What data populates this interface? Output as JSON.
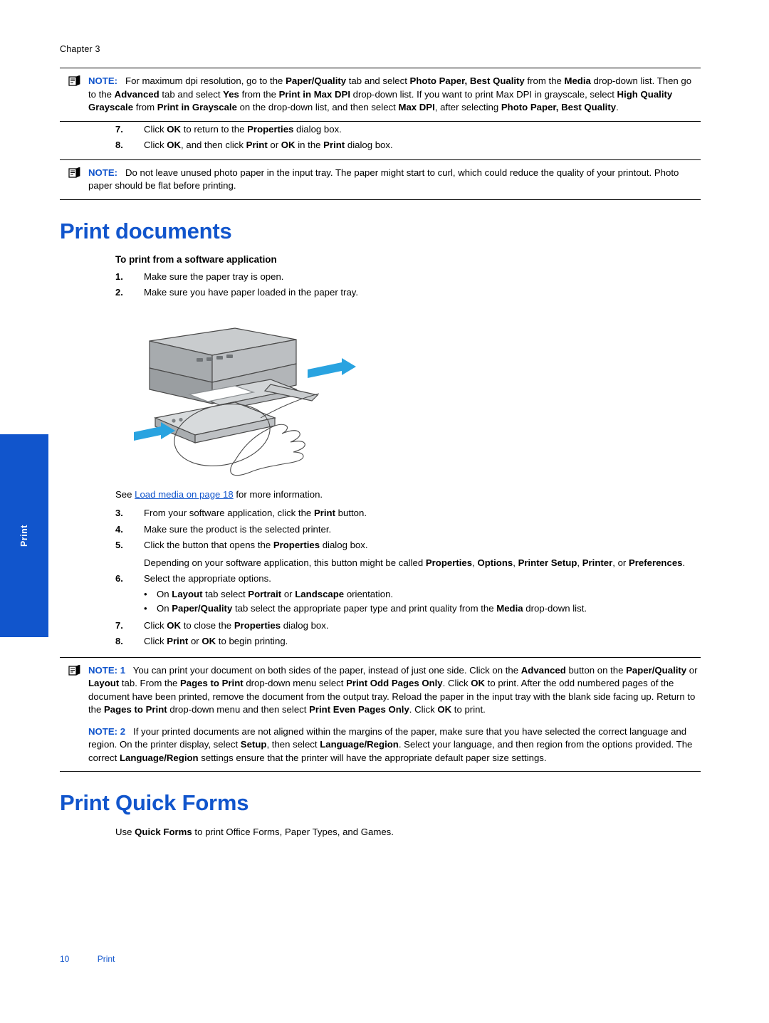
{
  "header": {
    "chapter": "Chapter 3"
  },
  "side_tab": {
    "label": "Print",
    "color": "#1155cc"
  },
  "notes": {
    "note1": {
      "label": "NOTE:",
      "icon": "note-pencil-icon",
      "text_runs": [
        {
          "t": "For maximum dpi resolution, go to the ",
          "b": false
        },
        {
          "t": "Paper/Quality",
          "b": true
        },
        {
          "t": " tab and select ",
          "b": false
        },
        {
          "t": "Photo Paper, Best Quality",
          "b": true
        },
        {
          "t": " from the ",
          "b": false
        },
        {
          "t": "Media",
          "b": true
        },
        {
          "t": " drop-down list. Then go to the ",
          "b": false
        },
        {
          "t": "Advanced",
          "b": true
        },
        {
          "t": " tab and select ",
          "b": false
        },
        {
          "t": "Yes",
          "b": true
        },
        {
          "t": " from the ",
          "b": false
        },
        {
          "t": "Print in Max DPI",
          "b": true
        },
        {
          "t": " drop-down list. If you want to print Max DPI in grayscale, select ",
          "b": false
        },
        {
          "t": "High Quality Grayscale",
          "b": true
        },
        {
          "t": " from ",
          "b": false
        },
        {
          "t": "Print in Grayscale",
          "b": true
        },
        {
          "t": " on the drop-down list, and then select ",
          "b": false
        },
        {
          "t": "Max DPI",
          "b": true
        },
        {
          "t": ", after selecting ",
          "b": false
        },
        {
          "t": "Photo Paper, Best Quality",
          "b": true
        },
        {
          "t": ".",
          "b": false
        }
      ]
    },
    "note2": {
      "label": "NOTE:",
      "icon": "note-pencil-icon",
      "text_runs": [
        {
          "t": "Do not leave unused photo paper in the input tray. The paper might start to curl, which could reduce the quality of your printout. Photo paper should be flat before printing.",
          "b": false
        }
      ]
    },
    "note3": {
      "label": "NOTE: 1",
      "icon": "note-pencil-icon",
      "text_runs": [
        {
          "t": "You can print your document on both sides of the paper, instead of just one side. Click on the ",
          "b": false
        },
        {
          "t": "Advanced",
          "b": true
        },
        {
          "t": " button on the ",
          "b": false
        },
        {
          "t": "Paper/Quality",
          "b": true
        },
        {
          "t": " or ",
          "b": false
        },
        {
          "t": "Layout",
          "b": true
        },
        {
          "t": " tab. From the ",
          "b": false
        },
        {
          "t": "Pages to Print",
          "b": true
        },
        {
          "t": " drop-down menu select ",
          "b": false
        },
        {
          "t": "Print Odd Pages Only",
          "b": true
        },
        {
          "t": ". Click ",
          "b": false
        },
        {
          "t": "OK",
          "b": true
        },
        {
          "t": " to print. After the odd numbered pages of the document have been printed, remove the document from the output tray. Reload the paper in the input tray with the blank side facing up. Return to the ",
          "b": false
        },
        {
          "t": "Pages to Print",
          "b": true
        },
        {
          "t": " drop-down menu and then select ",
          "b": false
        },
        {
          "t": "Print Even Pages Only",
          "b": true
        },
        {
          "t": ". Click ",
          "b": false
        },
        {
          "t": "OK",
          "b": true
        },
        {
          "t": " to print.",
          "b": false
        }
      ],
      "sub_label": "NOTE: 2",
      "sub_runs": [
        {
          "t": "If your printed documents are not aligned within the margins of the paper, make sure that you have selected the correct language and region. On the printer display, select ",
          "b": false
        },
        {
          "t": "Setup",
          "b": true
        },
        {
          "t": ", then select ",
          "b": false
        },
        {
          "t": "Language/Region",
          "b": true
        },
        {
          "t": ". Select your language, and then region from the options provided. The correct ",
          "b": false
        },
        {
          "t": "Language/Region",
          "b": true
        },
        {
          "t": " settings ensure that the printer will have the appropriate default paper size settings.",
          "b": false
        }
      ]
    }
  },
  "top_steps": [
    {
      "num": "7.",
      "runs": [
        {
          "t": "Click ",
          "b": false
        },
        {
          "t": "OK",
          "b": true
        },
        {
          "t": " to return to the ",
          "b": false
        },
        {
          "t": "Properties",
          "b": true
        },
        {
          "t": " dialog box.",
          "b": false
        }
      ]
    },
    {
      "num": "8.",
      "runs": [
        {
          "t": "Click ",
          "b": false
        },
        {
          "t": "OK",
          "b": true
        },
        {
          "t": ", and then click ",
          "b": false
        },
        {
          "t": "Print",
          "b": true
        },
        {
          "t": " or ",
          "b": false
        },
        {
          "t": "OK",
          "b": true
        },
        {
          "t": " in the ",
          "b": false
        },
        {
          "t": "Print",
          "b": true
        },
        {
          "t": " dialog box.",
          "b": false
        }
      ]
    }
  ],
  "section1": {
    "heading": "Print documents",
    "subhead": "To print from a software application",
    "steps_before_image": [
      {
        "num": "1.",
        "runs": [
          {
            "t": "Make sure the paper tray is open.",
            "b": false
          }
        ]
      },
      {
        "num": "2.",
        "runs": [
          {
            "t": "Make sure you have paper loaded in the paper tray.",
            "b": false
          }
        ]
      }
    ],
    "see_also": {
      "prefix": "See ",
      "link": "Load media on page 18",
      "suffix": " for more information."
    },
    "steps_after_image": [
      {
        "num": "3.",
        "runs": [
          {
            "t": "From your software application, click the ",
            "b": false
          },
          {
            "t": "Print",
            "b": true
          },
          {
            "t": " button.",
            "b": false
          }
        ]
      },
      {
        "num": "4.",
        "runs": [
          {
            "t": "Make sure the product is the selected printer.",
            "b": false
          }
        ]
      },
      {
        "num": "5.",
        "runs": [
          {
            "t": "Click the button that opens the ",
            "b": false
          },
          {
            "t": "Properties",
            "b": true
          },
          {
            "t": " dialog box.",
            "b": false
          }
        ],
        "extra_runs": [
          {
            "t": "Depending on your software application, this button might be called ",
            "b": false
          },
          {
            "t": "Properties",
            "b": true
          },
          {
            "t": ", ",
            "b": false
          },
          {
            "t": "Options",
            "b": true
          },
          {
            "t": ", ",
            "b": false
          },
          {
            "t": "Printer Setup",
            "b": true
          },
          {
            "t": ", ",
            "b": false
          },
          {
            "t": "Printer",
            "b": true
          },
          {
            "t": ", or ",
            "b": false
          },
          {
            "t": "Preferences",
            "b": true
          },
          {
            "t": ".",
            "b": false
          }
        ]
      },
      {
        "num": "6.",
        "runs": [
          {
            "t": "Select the appropriate options.",
            "b": false
          }
        ],
        "bullets": [
          [
            {
              "t": "On ",
              "b": false
            },
            {
              "t": "Layout",
              "b": true
            },
            {
              "t": " tab select ",
              "b": false
            },
            {
              "t": "Portrait",
              "b": true
            },
            {
              "t": " or ",
              "b": false
            },
            {
              "t": "Landscape",
              "b": true
            },
            {
              "t": " orientation.",
              "b": false
            }
          ],
          [
            {
              "t": "On ",
              "b": false
            },
            {
              "t": "Paper/Quality",
              "b": true
            },
            {
              "t": " tab select the appropriate paper type and print quality from the ",
              "b": false
            },
            {
              "t": "Media",
              "b": true
            },
            {
              "t": " drop-down list.",
              "b": false
            }
          ]
        ]
      },
      {
        "num": "7.",
        "runs": [
          {
            "t": "Click ",
            "b": false
          },
          {
            "t": "OK",
            "b": true
          },
          {
            "t": " to close the ",
            "b": false
          },
          {
            "t": "Properties",
            "b": true
          },
          {
            "t": " dialog box.",
            "b": false
          }
        ]
      },
      {
        "num": "8.",
        "runs": [
          {
            "t": "Click ",
            "b": false
          },
          {
            "t": "Print",
            "b": true
          },
          {
            "t": " or ",
            "b": false
          },
          {
            "t": "OK",
            "b": true
          },
          {
            "t": " to begin printing.",
            "b": false
          }
        ]
      }
    ]
  },
  "section2": {
    "heading": "Print Quick Forms",
    "body_runs": [
      {
        "t": "Use ",
        "b": false
      },
      {
        "t": "Quick Forms",
        "b": true
      },
      {
        "t": " to print Office Forms, Paper Types, and Games.",
        "b": false
      }
    ]
  },
  "footer": {
    "page_number": "10",
    "label": "Print",
    "color": "#1155cc"
  },
  "illustration": {
    "alt": "inkjet all-in-one printer with paper tray open and hand loading paper, blue arrows indicating motion"
  }
}
